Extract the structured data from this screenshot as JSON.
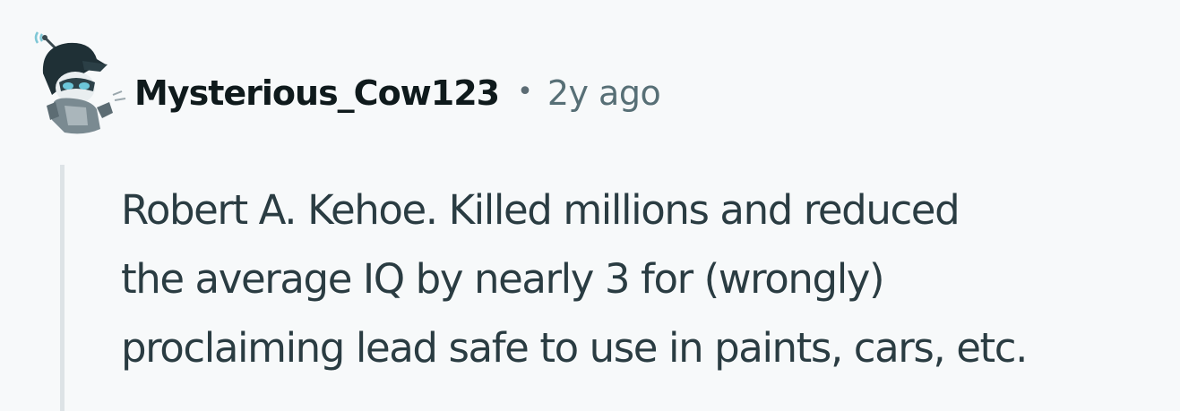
{
  "comment": {
    "author": "Mysterious_Cow123",
    "separator": "•",
    "time": "2y ago",
    "avatar_icon": "snoo-avatar-icon",
    "body_lines": [
      "Robert A. Kehoe. Killed millions and reduced",
      "the average IQ by nearly 3 for (wrongly)",
      "proclaiming lead safe to use in paints, cars, etc."
    ]
  },
  "colors": {
    "background": "#f7f9fa",
    "username": "#0f1a1c",
    "meta": "#576f76",
    "body": "#2a3c42",
    "thread_line": "#dde3e6"
  }
}
